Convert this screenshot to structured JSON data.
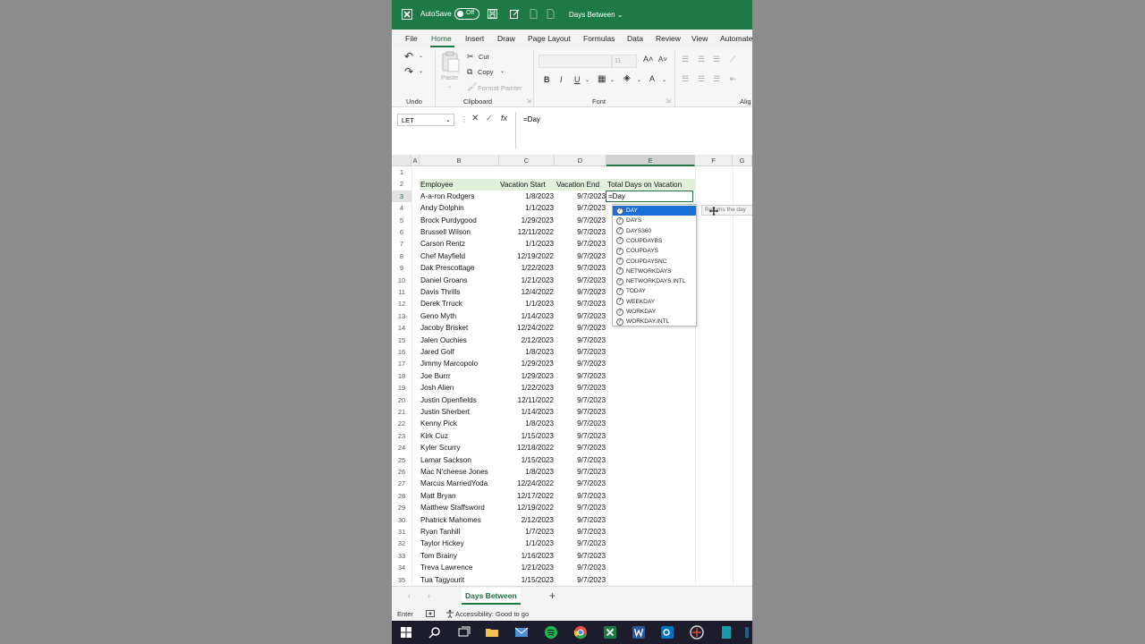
{
  "titlebar": {
    "autosave_label": "AutoSave",
    "autosave_state": "Off",
    "doc_title": "Days Between"
  },
  "tabs": [
    "File",
    "Home",
    "Insert",
    "Draw",
    "Page Layout",
    "Formulas",
    "Data",
    "Review",
    "View",
    "Automate"
  ],
  "active_tab": "Home",
  "ribbon": {
    "undo_label": "Undo",
    "clipboard_label": "Clipboard",
    "font_label": "Font",
    "alignment_label": "Alig",
    "paste_label": "Paste",
    "cut_label": "Cut",
    "copy_label": "Copy",
    "format_painter_label": "Format Painter",
    "font_size": "11",
    "bold": "B",
    "italic": "I",
    "underline": "U"
  },
  "formula_bar": {
    "name_box": "LET",
    "content": "=Day",
    "fx": "fx"
  },
  "columns": [
    "A",
    "B",
    "C",
    "D",
    "E",
    "F",
    "G"
  ],
  "header_row": {
    "employee": "Employee",
    "start": "Vacation Start",
    "end": "Vacation End",
    "total": "Total Days on Vacation"
  },
  "active_cell_text": "=Day",
  "rows": [
    {
      "n": "1",
      "name": "",
      "start": "",
      "end": ""
    },
    {
      "n": "2",
      "name": "",
      "start": "",
      "end": ""
    },
    {
      "n": "3",
      "name": "A-a-ron Rodgers",
      "start": "1/8/2023",
      "end": "9/7/2023"
    },
    {
      "n": "4",
      "name": "Andy Dolphin",
      "start": "1/1/2023",
      "end": "9/7/2023"
    },
    {
      "n": "5",
      "name": "Brock Purdygood",
      "start": "1/29/2023",
      "end": "9/7/2023"
    },
    {
      "n": "6",
      "name": "Brussell Wilson",
      "start": "12/11/2022",
      "end": "9/7/2023"
    },
    {
      "n": "7",
      "name": "Carson Rentz",
      "start": "1/1/2023",
      "end": "9/7/2023"
    },
    {
      "n": "8",
      "name": "Chef Mayfield",
      "start": "12/19/2022",
      "end": "9/7/2023"
    },
    {
      "n": "9",
      "name": "Dak Prescottage",
      "start": "1/22/2023",
      "end": "9/7/2023"
    },
    {
      "n": "10",
      "name": "Daniel Groans",
      "start": "1/21/2023",
      "end": "9/7/2023"
    },
    {
      "n": "11",
      "name": "Davis Thrills",
      "start": "12/4/2022",
      "end": "9/7/2023"
    },
    {
      "n": "12",
      "name": "Derek Trruck",
      "start": "1/1/2023",
      "end": "9/7/2023"
    },
    {
      "n": "13",
      "name": "Geno Myth",
      "start": "1/14/2023",
      "end": "9/7/2023"
    },
    {
      "n": "14",
      "name": "Jacoby Brisket",
      "start": "12/24/2022",
      "end": "9/7/2023"
    },
    {
      "n": "15",
      "name": "Jalen Ouchies",
      "start": "2/12/2023",
      "end": "9/7/2023"
    },
    {
      "n": "16",
      "name": "Jared Golf",
      "start": "1/8/2023",
      "end": "9/7/2023"
    },
    {
      "n": "17",
      "name": "Jimmy Marcopolo",
      "start": "1/29/2023",
      "end": "9/7/2023"
    },
    {
      "n": "18",
      "name": "Joe Burrr",
      "start": "1/29/2023",
      "end": "9/7/2023"
    },
    {
      "n": "19",
      "name": "Josh Alien",
      "start": "1/22/2023",
      "end": "9/7/2023"
    },
    {
      "n": "20",
      "name": "Justin Openfields",
      "start": "12/11/2022",
      "end": "9/7/2023"
    },
    {
      "n": "21",
      "name": "Justin Sherbert",
      "start": "1/14/2023",
      "end": "9/7/2023"
    },
    {
      "n": "22",
      "name": "Kenny Pick",
      "start": "1/8/2023",
      "end": "9/7/2023"
    },
    {
      "n": "23",
      "name": "Kirk Cuz",
      "start": "1/15/2023",
      "end": "9/7/2023"
    },
    {
      "n": "24",
      "name": "Kyler Scurry",
      "start": "12/18/2022",
      "end": "9/7/2023"
    },
    {
      "n": "25",
      "name": "Lamar Sackson",
      "start": "1/15/2023",
      "end": "9/7/2023"
    },
    {
      "n": "26",
      "name": "Mac N'cheese Jones",
      "start": "1/8/2023",
      "end": "9/7/2023"
    },
    {
      "n": "27",
      "name": "Marcus MarriedYoda",
      "start": "12/24/2022",
      "end": "9/7/2023"
    },
    {
      "n": "28",
      "name": "Matt Bryan",
      "start": "12/17/2022",
      "end": "9/7/2023"
    },
    {
      "n": "29",
      "name": "Matthew Staffsword",
      "start": "12/19/2022",
      "end": "9/7/2023"
    },
    {
      "n": "30",
      "name": "Phatrick Mahomes",
      "start": "2/12/2023",
      "end": "9/7/2023"
    },
    {
      "n": "31",
      "name": "Ryan Tanhill",
      "start": "1/7/2023",
      "end": "9/7/2023"
    },
    {
      "n": "32",
      "name": "Taylor Hickey",
      "start": "1/1/2023",
      "end": "9/7/2023"
    },
    {
      "n": "33",
      "name": "Tom Brainy",
      "start": "1/16/2023",
      "end": "9/7/2023"
    },
    {
      "n": "34",
      "name": "Treva Lawrence",
      "start": "1/21/2023",
      "end": "9/7/2023"
    },
    {
      "n": "35",
      "name": "Tua Tagyourit",
      "start": "1/15/2023",
      "end": "9/7/2023"
    }
  ],
  "autocomplete": {
    "items": [
      "DAY",
      "DAYS",
      "DAYS360",
      "COUPDAYBS",
      "COUPDAYS",
      "COUPDAYSNC",
      "NETWORKDAYS",
      "NETWORKDAYS.INTL",
      "TODAY",
      "WEEKDAY",
      "WORKDAY",
      "WORKDAY.INTL"
    ],
    "selected": "DAY",
    "tooltip": "Returns the day"
  },
  "sheet_tab": "Days Between",
  "status": {
    "mode": "Enter",
    "accessibility": "Accessibility: Good to go"
  },
  "colors": {
    "excel_green": "#1d7a45",
    "header_fill": "#e2efda",
    "selection_blue": "#1a6fd8"
  }
}
